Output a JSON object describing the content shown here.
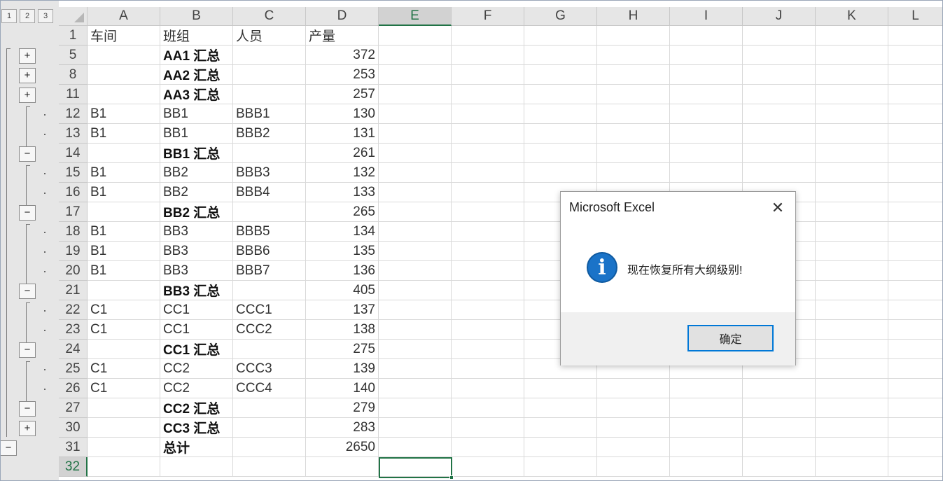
{
  "outline": {
    "levels": [
      "1",
      "2",
      "3"
    ],
    "expand_symbol": "+",
    "collapse_symbol": "−"
  },
  "columns": [
    "A",
    "B",
    "C",
    "D",
    "E",
    "F",
    "G",
    "H",
    "I",
    "J",
    "K",
    "L"
  ],
  "selected_column": "E",
  "rows": [
    {
      "num": "1",
      "a": "车间",
      "b": "班组",
      "c": "人员",
      "d": "产量",
      "bold": false,
      "d_num": false
    },
    {
      "num": "5",
      "a": "",
      "b": "AA1 汇总",
      "c": "",
      "d": "372",
      "bold": true
    },
    {
      "num": "8",
      "a": "",
      "b": "AA2 汇总",
      "c": "",
      "d": "253",
      "bold": true
    },
    {
      "num": "11",
      "a": "",
      "b": "AA3 汇总",
      "c": "",
      "d": "257",
      "bold": true
    },
    {
      "num": "12",
      "a": "B1",
      "b": "BB1",
      "c": "BBB1",
      "d": "130",
      "bold": false
    },
    {
      "num": "13",
      "a": "B1",
      "b": "BB1",
      "c": "BBB2",
      "d": "131",
      "bold": false
    },
    {
      "num": "14",
      "a": "",
      "b": "BB1 汇总",
      "c": "",
      "d": "261",
      "bold": true
    },
    {
      "num": "15",
      "a": "B1",
      "b": "BB2",
      "c": "BBB3",
      "d": "132",
      "bold": false
    },
    {
      "num": "16",
      "a": "B1",
      "b": "BB2",
      "c": "BBB4",
      "d": "133",
      "bold": false
    },
    {
      "num": "17",
      "a": "",
      "b": "BB2 汇总",
      "c": "",
      "d": "265",
      "bold": true
    },
    {
      "num": "18",
      "a": "B1",
      "b": "BB3",
      "c": "BBB5",
      "d": "134",
      "bold": false
    },
    {
      "num": "19",
      "a": "B1",
      "b": "BB3",
      "c": "BBB6",
      "d": "135",
      "bold": false
    },
    {
      "num": "20",
      "a": "B1",
      "b": "BB3",
      "c": "BBB7",
      "d": "136",
      "bold": false
    },
    {
      "num": "21",
      "a": "",
      "b": "BB3 汇总",
      "c": "",
      "d": "405",
      "bold": true
    },
    {
      "num": "22",
      "a": "C1",
      "b": "CC1",
      "c": "CCC1",
      "d": "137",
      "bold": false
    },
    {
      "num": "23",
      "a": "C1",
      "b": "CC1",
      "c": "CCC2",
      "d": "138",
      "bold": false
    },
    {
      "num": "24",
      "a": "",
      "b": "CC1 汇总",
      "c": "",
      "d": "275",
      "bold": true
    },
    {
      "num": "25",
      "a": "C1",
      "b": "CC2",
      "c": "CCC3",
      "d": "139",
      "bold": false
    },
    {
      "num": "26",
      "a": "C1",
      "b": "CC2",
      "c": "CCC4",
      "d": "140",
      "bold": false
    },
    {
      "num": "27",
      "a": "",
      "b": "CC2 汇总",
      "c": "",
      "d": "279",
      "bold": true
    },
    {
      "num": "30",
      "a": "",
      "b": "CC3 汇总",
      "c": "",
      "d": "283",
      "bold": true
    },
    {
      "num": "31",
      "a": "",
      "b": "总计",
      "c": "",
      "d": "2650",
      "bold": true
    },
    {
      "num": "32",
      "a": "",
      "b": "",
      "c": "",
      "d": "",
      "bold": false,
      "selected": true
    }
  ],
  "dialog": {
    "title": "Microsoft Excel",
    "close_symbol": "✕",
    "icon": "info-icon",
    "icon_glyph": "i",
    "message": "现在恢复所有大纲级别!",
    "ok_label": "确定",
    "accent_color": "#0078d7"
  },
  "colors": {
    "selection": "#217346",
    "header_bg": "#e6e6e6",
    "gridline": "#d9d9d9"
  }
}
